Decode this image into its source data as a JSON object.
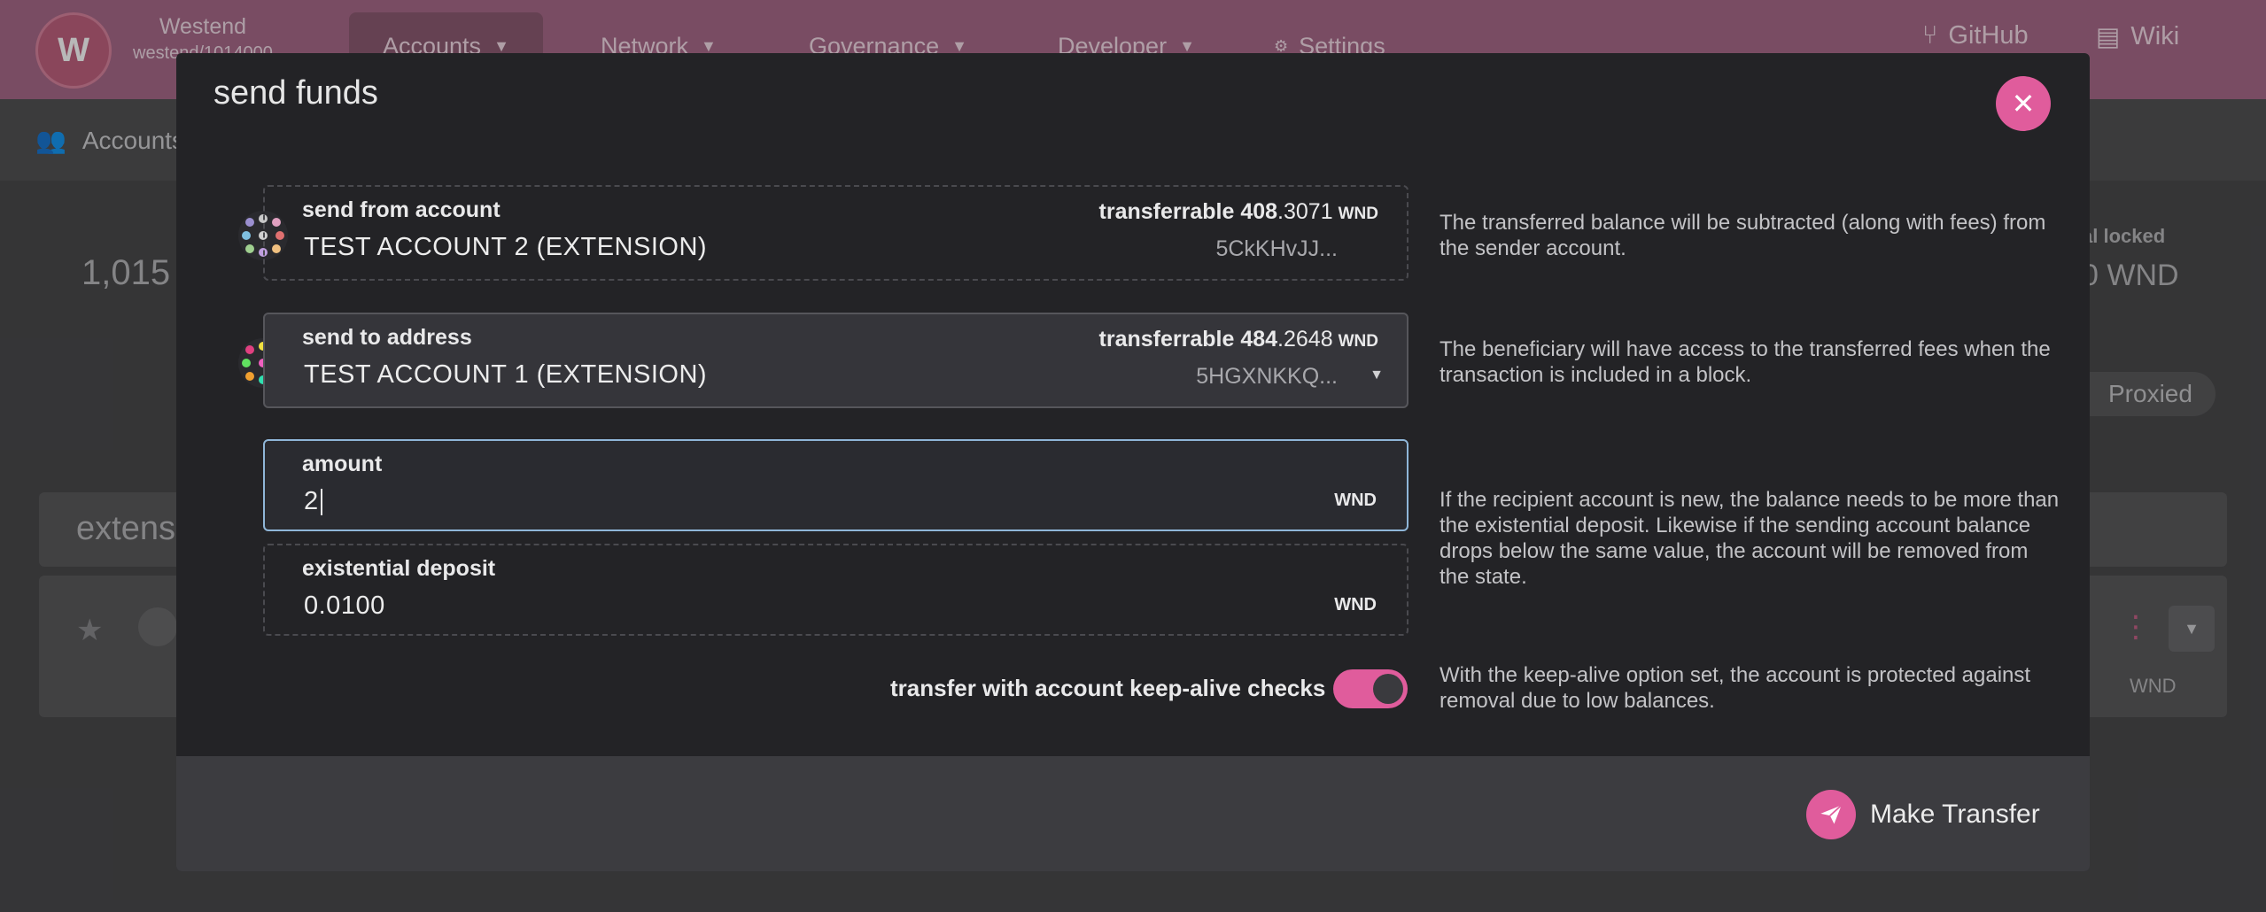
{
  "app": {
    "chain_name": "Westend",
    "chain_block": "westend/1014000",
    "nav": [
      {
        "label": "Accounts",
        "active": true
      },
      {
        "label": "Network"
      },
      {
        "label": "Governance"
      },
      {
        "label": "Developer"
      },
      {
        "label": "Settings"
      }
    ],
    "github_label": "GitHub",
    "wiki_label": "Wiki",
    "subnav_label": "Accounts",
    "bg_balance": "1,015",
    "bg_total_locked_label": "al locked",
    "bg_total_locked_value": "0 WND",
    "bg_proxied_label": "Proxied",
    "bg_panel_title": "extens",
    "bg_row_unit": "WND"
  },
  "modal": {
    "title": "send funds",
    "from": {
      "label": "send from account",
      "account_name": "TEST ACCOUNT 2 (EXTENSION)",
      "transferrable_label": "transferrable",
      "balance_int": "408",
      "balance_dec": ".3071",
      "unit": "WND",
      "address": "5CkKHvJJ...",
      "help": "The transferred balance will be subtracted (along with fees) from the sender account."
    },
    "to": {
      "label": "send to address",
      "account_name": "TEST ACCOUNT 1 (EXTENSION)",
      "transferrable_label": "transferrable",
      "balance_int": "484",
      "balance_dec": ".2648",
      "unit": "WND",
      "address": "5HGXNKKQ...",
      "help": "The beneficiary will have access to the transferred fees when the transaction is included in a block."
    },
    "amount": {
      "label": "amount",
      "value": "2",
      "unit": "WND",
      "help": "If the recipient account is new, the balance needs to be more than the existential deposit. Likewise if the sending account balance drops below the same value, the account will be removed from the state."
    },
    "existential_deposit": {
      "label": "existential deposit",
      "value": "0.0100",
      "unit": "WND"
    },
    "keep_alive": {
      "label": "transfer with account keep-alive checks",
      "enabled": true,
      "help": "With the keep-alive option set, the account is protected against removal due to low balances."
    },
    "submit_label": "Make Transfer"
  },
  "colors": {
    "accent": "#e05c9c",
    "topbar": "#a86a8a",
    "modal_bg": "#232326"
  }
}
